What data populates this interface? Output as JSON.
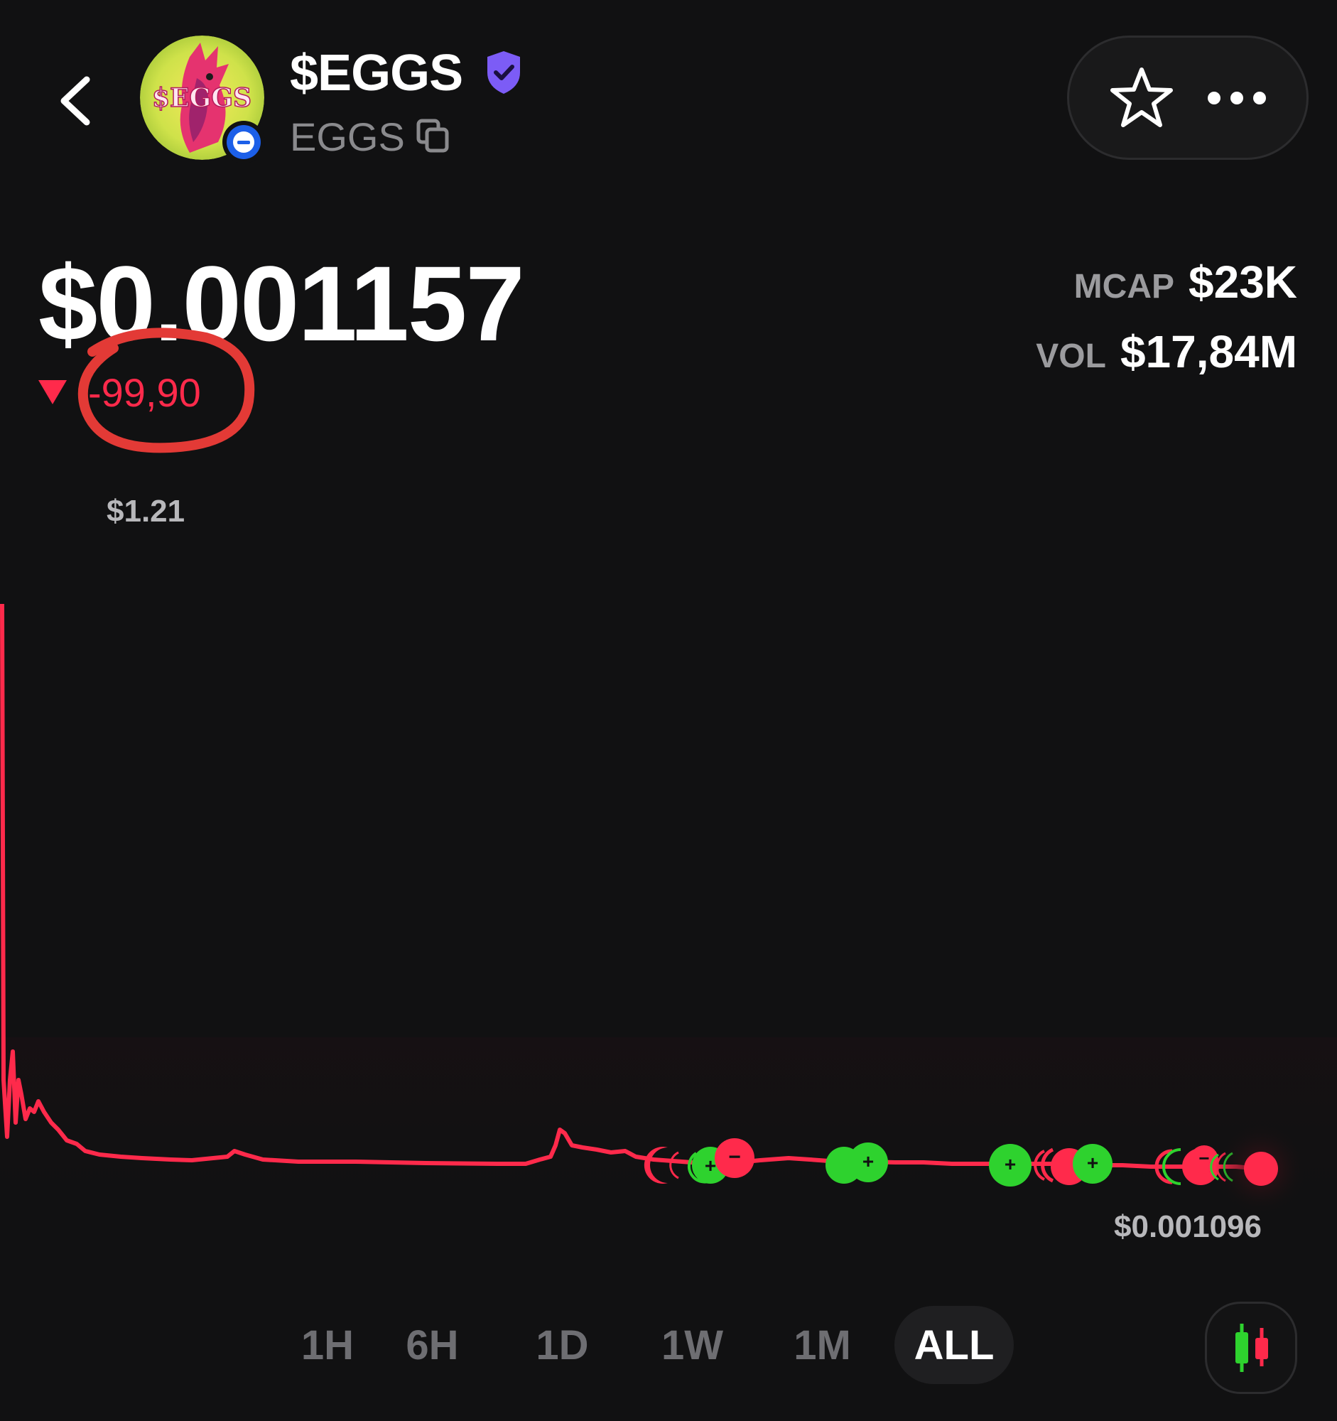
{
  "header": {
    "token_name": "$EGGS",
    "token_symbol": "EGGS",
    "avatar_text": "$EGGS",
    "icons": [
      "back-arrow-icon",
      "verified-shield-icon",
      "copy-icon",
      "star-icon",
      "more-icon",
      "chain-badge-icon"
    ]
  },
  "price": {
    "current": "$0.001157",
    "change": "-99,90",
    "change_direction": "down"
  },
  "stats": {
    "mcap_label": "MCAP",
    "mcap_value": "$23K",
    "vol_label": "VOL",
    "vol_value": "$17,84M"
  },
  "chart": {
    "high_label": "$1.21",
    "low_label": "$0.001096"
  },
  "ranges": {
    "items": [
      "1H",
      "6H",
      "1D",
      "1W",
      "1M",
      "ALL"
    ],
    "active": "ALL"
  },
  "colors": {
    "background": "#111112",
    "line": "#ff2a4b",
    "buy_marker": "#2ed22e",
    "sell_marker": "#ff2a4b",
    "verified": "#7c5cf6",
    "annotation": "#e33a36"
  },
  "chart_data": {
    "type": "line",
    "title": "",
    "xlabel": "",
    "ylabel": "",
    "max_label": "$1.21",
    "min_label": "$0.001096",
    "note": "Price drop of approximately 99.9% over ALL time range; buy (+) and sell (-) trade markers along the tail"
  }
}
